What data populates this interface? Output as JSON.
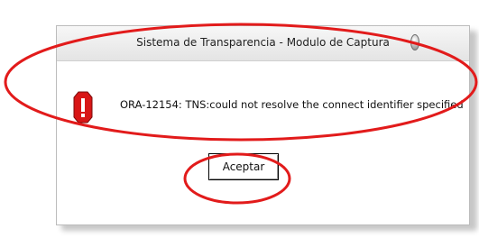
{
  "dialog": {
    "title": "Sistema de Transparencia - Modulo de Captura",
    "message": "ORA-12154: TNS:could not resolve the connect identifier specified",
    "ok_label": "Aceptar",
    "icon": "error-octagon-icon",
    "close_icon": "close-icon"
  },
  "annotations": {
    "color": "#e21b1b"
  }
}
